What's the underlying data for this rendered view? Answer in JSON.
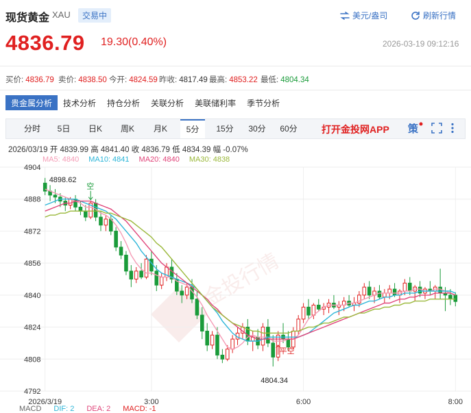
{
  "header": {
    "title": "现货黄金",
    "code": "XAU",
    "status": "交易中",
    "unit_label": "美元/盎司",
    "refresh_label": "刷新行情",
    "price": "4836.79",
    "change": "19.30(0.40%)",
    "datetime": "2026-03-19 09:12:16"
  },
  "quotes": [
    {
      "label": "买价:",
      "value": "4836.79",
      "color": "#e02020"
    },
    {
      "label": "卖价:",
      "value": "4838.50",
      "color": "#e02020"
    },
    {
      "label": "今开:",
      "value": "4824.59",
      "color": "#e02020"
    },
    {
      "label": "昨收:",
      "value": "4817.49",
      "color": "#333333"
    },
    {
      "label": "最高:",
      "value": "4853.22",
      "color": "#e02020"
    },
    {
      "label": "最低:",
      "value": "4804.34",
      "color": "#1a9b3a"
    }
  ],
  "analysis_tabs": [
    "贵金属分析",
    "技术分析",
    "持仓分析",
    "关联分析",
    "美联储利率",
    "季节分析"
  ],
  "period_tabs": [
    "分时",
    "5日",
    "日K",
    "周K",
    "月K",
    "5分",
    "15分",
    "30分",
    "60分"
  ],
  "active_period": 5,
  "app_ad": "打开金投网APP",
  "ohlc": "2026/03/19  开 4839.99  高 4841.40  收 4836.79  低 4834.39  幅 -0.07%",
  "ma": [
    {
      "label": "MA5: 4840",
      "color": "#f59bb5"
    },
    {
      "label": "MA10: 4841",
      "color": "#2bb5d8"
    },
    {
      "label": "MA20: 4840",
      "color": "#e0457a"
    },
    {
      "label": "MA30: 4838",
      "color": "#9ab83a"
    }
  ],
  "macd": [
    {
      "label": "MACD",
      "color": "#666666"
    },
    {
      "label": "DIF: 2",
      "color": "#2bb5d8"
    },
    {
      "label": "DEA: 2",
      "color": "#e0457a"
    },
    {
      "label": "MACD: -1",
      "color": "#e02020"
    }
  ],
  "chart_data": {
    "type": "candlestick",
    "ylim": [
      4792,
      4904
    ],
    "y_ticks": [
      4904,
      4888,
      4872,
      4856,
      4840,
      4824,
      4808,
      4792
    ],
    "x_tick_labels": [
      "2026/3/19",
      "3:00",
      "6:00",
      "8:00",
      "2026/3/19"
    ],
    "x_tick_positions": [
      0,
      21,
      51,
      81,
      94
    ],
    "annotations": {
      "max_label": "4898.62",
      "min_label": "4804.34",
      "short_signal": "空",
      "flat_short_signal": "平空"
    },
    "candles": [
      [
        4896,
        4898.6,
        4890,
        4892
      ],
      [
        4892,
        4895,
        4887,
        4890
      ],
      [
        4890,
        4893,
        4886,
        4889
      ],
      [
        4889,
        4891,
        4884,
        4887
      ],
      [
        4887,
        4889,
        4882,
        4885
      ],
      [
        4885,
        4889,
        4883,
        4888
      ],
      [
        4888,
        4890,
        4882,
        4884
      ],
      [
        4884,
        4887,
        4880,
        4882
      ],
      [
        4882,
        4885,
        4877,
        4879
      ],
      [
        4879,
        4887,
        4878,
        4886
      ],
      [
        4886,
        4888,
        4877,
        4879
      ],
      [
        4879,
        4882,
        4872,
        4875
      ],
      [
        4875,
        4880,
        4872,
        4878
      ],
      [
        4878,
        4880,
        4870,
        4872
      ],
      [
        4872,
        4874,
        4862,
        4864
      ],
      [
        4864,
        4867,
        4858,
        4860
      ],
      [
        4860,
        4862,
        4850,
        4852
      ],
      [
        4852,
        4855,
        4844,
        4848
      ],
      [
        4848,
        4854,
        4846,
        4852
      ],
      [
        4852,
        4856,
        4848,
        4849
      ],
      [
        4849,
        4860,
        4848,
        4858
      ],
      [
        4858,
        4862,
        4850,
        4852
      ],
      [
        4852,
        4855,
        4842,
        4845
      ],
      [
        4845,
        4851,
        4843,
        4849
      ],
      [
        4849,
        4856,
        4847,
        4854
      ],
      [
        4854,
        4858,
        4846,
        4848
      ],
      [
        4848,
        4851,
        4840,
        4842
      ],
      [
        4842,
        4845,
        4836,
        4840
      ],
      [
        4840,
        4846,
        4838,
        4844
      ],
      [
        4844,
        4848,
        4836,
        4838
      ],
      [
        4838,
        4842,
        4828,
        4830
      ],
      [
        4830,
        4834,
        4818,
        4822
      ],
      [
        4822,
        4826,
        4812,
        4815
      ],
      [
        4815,
        4822,
        4813,
        4820
      ],
      [
        4820,
        4824,
        4808,
        4810
      ],
      [
        4810,
        4813,
        4806,
        4808
      ],
      [
        4808,
        4815,
        4807,
        4813
      ],
      [
        4813,
        4820,
        4811,
        4818
      ],
      [
        4818,
        4824,
        4815,
        4821
      ],
      [
        4821,
        4826,
        4818,
        4824
      ],
      [
        4824,
        4828,
        4815,
        4817
      ],
      [
        4817,
        4822,
        4812,
        4819
      ],
      [
        4819,
        4823,
        4813,
        4815
      ],
      [
        4815,
        4826,
        4812,
        4824
      ],
      [
        4824,
        4828,
        4814,
        4816
      ],
      [
        4816,
        4820,
        4804.3,
        4809
      ],
      [
        4809,
        4822,
        4807,
        4820
      ],
      [
        4820,
        4826,
        4816,
        4818
      ],
      [
        4818,
        4822,
        4812,
        4814
      ],
      [
        4814,
        4824,
        4813,
        4822
      ],
      [
        4822,
        4830,
        4820,
        4828
      ],
      [
        4828,
        4836,
        4826,
        4834
      ],
      [
        4834,
        4838,
        4828,
        4830
      ],
      [
        4830,
        4836,
        4828,
        4835
      ],
      [
        4835,
        4838,
        4832,
        4833
      ],
      [
        4833,
        4836,
        4830,
        4834
      ],
      [
        4834,
        4838,
        4831,
        4836
      ],
      [
        4836,
        4840,
        4833,
        4834
      ],
      [
        4834,
        4837,
        4830,
        4835
      ],
      [
        4835,
        4839,
        4832,
        4837
      ],
      [
        4837,
        4840,
        4834,
        4835
      ],
      [
        4835,
        4839,
        4832,
        4836
      ],
      [
        4836,
        4842,
        4834,
        4840
      ],
      [
        4840,
        4846,
        4838,
        4844
      ],
      [
        4844,
        4847,
        4838,
        4840
      ],
      [
        4840,
        4844,
        4836,
        4842
      ],
      [
        4842,
        4845,
        4838,
        4839
      ],
      [
        4839,
        4843,
        4836,
        4841
      ],
      [
        4841,
        4845,
        4838,
        4843
      ],
      [
        4843,
        4846,
        4839,
        4840
      ],
      [
        4840,
        4843,
        4836,
        4842
      ],
      [
        4842,
        4848,
        4840,
        4846
      ],
      [
        4846,
        4849,
        4840,
        4842
      ],
      [
        4842,
        4845,
        4837,
        4844
      ],
      [
        4844,
        4847,
        4839,
        4841
      ],
      [
        4841,
        4844,
        4838,
        4843
      ],
      [
        4843,
        4847,
        4840,
        4842
      ],
      [
        4842,
        4845,
        4838,
        4844
      ],
      [
        4844,
        4853.2,
        4838,
        4841
      ],
      [
        4841,
        4844,
        4832,
        4840
      ],
      [
        4840,
        4843,
        4835,
        4838
      ],
      [
        4839.99,
        4841.4,
        4834.39,
        4836.79
      ]
    ],
    "ma_series": [
      {
        "name": "MA5",
        "color": "#f59bb5",
        "values": [
          4893,
          4892,
          4891,
          4890,
          4889,
          4888,
          4887,
          4886,
          4884,
          4884,
          4883,
          4881,
          4880,
          4878,
          4875,
          4871,
          4866,
          4860,
          4856,
          4853,
          4851,
          4851,
          4850,
          4849,
          4849,
          4849,
          4847,
          4846,
          4845,
          4842,
          4839,
          4835,
          4830,
          4826,
          4822,
          4818,
          4814,
          4813,
          4814,
          4816,
          4819,
          4820,
          4819,
          4819,
          4819,
          4817,
          4817,
          4817,
          4818,
          4818,
          4820,
          4824,
          4828,
          4830,
          4832,
          4834,
          4835,
          4835,
          4835,
          4835,
          4836,
          4836,
          4837,
          4838,
          4839,
          4840,
          4841,
          4841,
          4841,
          4841,
          4841,
          4842,
          4842,
          4843,
          4843,
          4842,
          4842,
          4843,
          4843,
          4842,
          4841,
          4840
        ]
      },
      {
        "name": "MA10",
        "color": "#2bb5d8",
        "values": [
          4885,
          4886,
          4887,
          4888,
          4888,
          4888,
          4888,
          4887,
          4886,
          4885,
          4884,
          4883,
          4882,
          4880,
          4878,
          4875,
          4872,
          4869,
          4866,
          4862,
          4859,
          4856,
          4853,
          4851,
          4850,
          4849,
          4848,
          4847,
          4846,
          4845,
          4843,
          4840,
          4837,
          4834,
          4831,
          4827,
          4824,
          4821,
          4819,
          4818,
          4817,
          4817,
          4817,
          4818,
          4819,
          4819,
          4819,
          4819,
          4819,
          4819,
          4819,
          4820,
          4821,
          4823,
          4825,
          4827,
          4829,
          4831,
          4832,
          4833,
          4834,
          4835,
          4835,
          4836,
          4837,
          4837,
          4838,
          4839,
          4839,
          4840,
          4840,
          4841,
          4841,
          4841,
          4842,
          4842,
          4842,
          4842,
          4842,
          4842,
          4842,
          4841
        ]
      },
      {
        "name": "MA20",
        "color": "#e0457a",
        "values": [
          4882,
          4883,
          4884,
          4885,
          4886,
          4886,
          4887,
          4887,
          4887,
          4887,
          4886,
          4885,
          4884,
          4883,
          4881,
          4879,
          4877,
          4874,
          4871,
          4868,
          4865,
          4862,
          4859,
          4856,
          4854,
          4852,
          4850,
          4848,
          4846,
          4844,
          4842,
          4840,
          4838,
          4835,
          4833,
          4830,
          4828,
          4826,
          4824,
          4822,
          4820,
          4819,
          4818,
          4818,
          4818,
          4818,
          4818,
          4818,
          4818,
          4818,
          4819,
          4820,
          4821,
          4822,
          4823,
          4824,
          4825,
          4826,
          4827,
          4828,
          4829,
          4830,
          4831,
          4832,
          4833,
          4834,
          4835,
          4836,
          4836,
          4837,
          4838,
          4838,
          4839,
          4839,
          4840,
          4840,
          4840,
          4841,
          4841,
          4841,
          4841,
          4840
        ]
      },
      {
        "name": "MA30",
        "color": "#9ab83a",
        "values": [
          4879,
          4880,
          4880,
          4881,
          4881,
          4882,
          4882,
          4882,
          4882,
          4882,
          4882,
          4882,
          4881,
          4881,
          4880,
          4879,
          4878,
          4877,
          4875,
          4873,
          4871,
          4869,
          4866,
          4864,
          4861,
          4858,
          4855,
          4852,
          4849,
          4846,
          4843,
          4840,
          4837,
          4834,
          4832,
          4830,
          4828,
          4826,
          4825,
          4824,
          4823,
          4822,
          4822,
          4821,
          4821,
          4821,
          4821,
          4821,
          4821,
          4822,
          4822,
          4823,
          4824,
          4824,
          4825,
          4826,
          4826,
          4827,
          4828,
          4829,
          4829,
          4830,
          4831,
          4831,
          4832,
          4833,
          4833,
          4834,
          4834,
          4835,
          4835,
          4836,
          4836,
          4837,
          4837,
          4837,
          4838,
          4838,
          4838,
          4838,
          4838,
          4838
        ]
      }
    ]
  }
}
